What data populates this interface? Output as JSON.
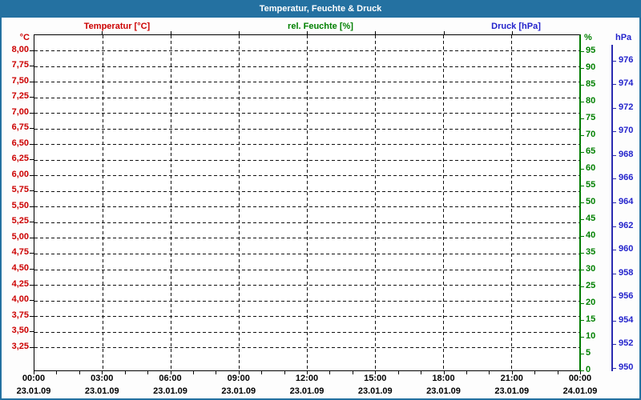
{
  "title_bar": {
    "title": "Temperatur, Feuchte & Druck"
  },
  "legend": [
    {
      "label": "Temperatur [°C]"
    },
    {
      "label": "rel. Feuchte [%]"
    },
    {
      "label": "Druck [hPa]"
    }
  ],
  "colors": {
    "temp": "#cc0000",
    "humidity": "#008000",
    "humidity_line": "#007a00",
    "pressure": "#2323cc",
    "pressure_line": "#2b2bb0",
    "frame": "#2471a1",
    "grid": "#000000",
    "background": "#ffffff"
  },
  "chart_data": {
    "type": "line",
    "title": "Temperatur, Feuchte & Druck",
    "note": "Plot area is empty: gridlines and three value axes are drawn but no data curves are visible.",
    "grid": "dashed black, horizontal lines at every temperature tick, vertical lines every 3 hours",
    "series": [
      {
        "name": "Temperatur [°C]",
        "axis": "temp",
        "values": []
      },
      {
        "name": "rel. Feuchte [%]",
        "axis": "humidity",
        "values": []
      },
      {
        "name": "Druck [hPa]",
        "axis": "pressure",
        "values": []
      }
    ],
    "x_axis": {
      "span_hours": 24,
      "major_tick_interval_hours": 3,
      "minor_tick_interval_hours": 1,
      "major_ticks": [
        {
          "time": "00:00",
          "date": "23.01.09"
        },
        {
          "time": "03:00",
          "date": "23.01.09"
        },
        {
          "time": "06:00",
          "date": "23.01.09"
        },
        {
          "time": "09:00",
          "date": "23.01.09"
        },
        {
          "time": "12:00",
          "date": "23.01.09"
        },
        {
          "time": "15:00",
          "date": "23.01.09"
        },
        {
          "time": "18:00",
          "date": "23.01.09"
        },
        {
          "time": "21:00",
          "date": "23.01.09"
        },
        {
          "time": "00:00",
          "date": "24.01.09"
        }
      ]
    },
    "y_axes": {
      "temp": {
        "header": "°C",
        "side": "left",
        "top_value": 8.25,
        "bottom_value": 2.875,
        "tick_values": [
          8.0,
          7.75,
          7.5,
          7.25,
          7.0,
          6.75,
          6.5,
          6.25,
          6.0,
          5.75,
          5.5,
          5.25,
          5.0,
          4.75,
          4.5,
          4.25,
          4.0,
          3.75,
          3.5,
          3.25
        ],
        "tick_labels": [
          "8,00",
          "7,75",
          "7,50",
          "7,25",
          "7,00",
          "6,75",
          "6,50",
          "6,25",
          "6,00",
          "5,75",
          "5,50",
          "5,25",
          "5,00",
          "4,75",
          "4,50",
          "4,25",
          "4,00",
          "3,75",
          "3,50",
          "3,25"
        ]
      },
      "humidity": {
        "header": "%",
        "side": "right-inner",
        "top_value": 100,
        "bottom_value": 0,
        "tick_values": [
          95,
          90,
          85,
          80,
          75,
          70,
          65,
          60,
          55,
          50,
          45,
          40,
          35,
          30,
          25,
          20,
          15,
          10,
          5,
          0
        ],
        "tick_labels": [
          "95",
          "90",
          "85",
          "80",
          "75",
          "70",
          "65",
          "60",
          "55",
          "50",
          "45",
          "40",
          "35",
          "30",
          "25",
          "20",
          "15",
          "10",
          "5",
          "0"
        ]
      },
      "pressure": {
        "header": "hPa",
        "side": "right-outer",
        "top_value": 978.2,
        "bottom_value": 949.8,
        "tick_values": [
          976,
          974,
          972,
          970,
          968,
          966,
          964,
          962,
          960,
          958,
          956,
          954,
          952,
          950
        ],
        "tick_labels": [
          "976",
          "974",
          "972",
          "970",
          "968",
          "966",
          "964",
          "962",
          "960",
          "958",
          "956",
          "954",
          "952",
          "950"
        ]
      }
    }
  }
}
